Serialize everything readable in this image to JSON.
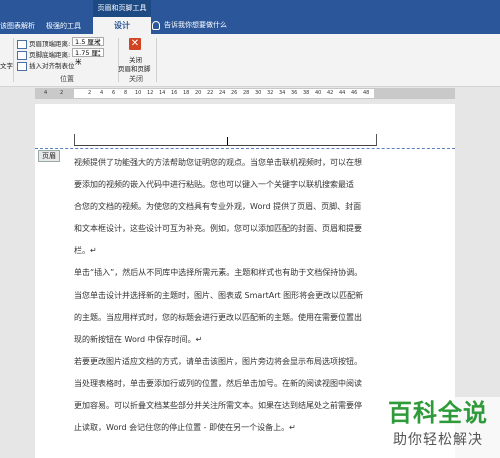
{
  "titlebar": {
    "contextual_group": "页眉和页脚工具",
    "tabs": [
      "该图表解析",
      "极强的工具"
    ],
    "active_tab": "设计",
    "tell_me": "告诉我你想要做什么"
  },
  "ribbon": {
    "left_cut_label": "文字",
    "header_top_label": "页眉顶端距离:",
    "header_top_value": "1.5 厘米",
    "footer_bottom_label": "页脚底端距离:",
    "footer_bottom_value": "1.75 厘米",
    "insert_align_tab": "插入对齐制表位",
    "position_group": "位置",
    "close_line1": "关闭",
    "close_line2": "页眉和页脚",
    "close_group": "关闭"
  },
  "ruler": {
    "ticks": [
      "4",
      "2",
      "2",
      "4",
      "6",
      "8",
      "10",
      "12",
      "14",
      "16",
      "18",
      "20",
      "22",
      "24",
      "26",
      "28",
      "30",
      "32",
      "34",
      "36",
      "38",
      "40",
      "42",
      "44",
      "46",
      "48"
    ]
  },
  "document": {
    "header_tag": "页眉",
    "lines": [
      "视频提供了功能强大的方法帮助您证明您的观点。当您单击联机视频时，可以在想",
      "要添加的视频的嵌入代码中进行粘贴。您也可以键入一个关键字以联机搜索最适",
      "合您的文档的视频。为使您的文档具有专业外观，Word 提供了页眉、页脚、封面",
      "和文本框设计，这些设计可互为补充。例如，您可以添加匹配的封面、页眉和提要",
      "栏。↵",
      "单击“插入”，然后从不同库中选择所需元素。主题和样式也有助于文档保持协调。",
      "当您单击设计并选择新的主题时，图片、图表或 SmartArt 图形将会更改以匹配新",
      "的主题。当应用样式时，您的标题会进行更改以匹配新的主题。使用在需要位置出",
      "现的新按钮在 Word 中保存时间。↵",
      "若要更改图片适应文档的方式，请单击该图片，图片旁边将会显示布局选项按钮。",
      "当处理表格时，单击要添加行或列的位置，然后单击加号。在新的阅读视图中阅读",
      "更加容易。可以折叠文档某些部分并关注所需文本。如果在达到结尾处之前需要停",
      "止读取，Word 会记住您的停止位置 - 即使在另一个设备上。↵"
    ]
  },
  "watermark": {
    "top": "百科全说",
    "bottom": "助你轻松解决"
  }
}
